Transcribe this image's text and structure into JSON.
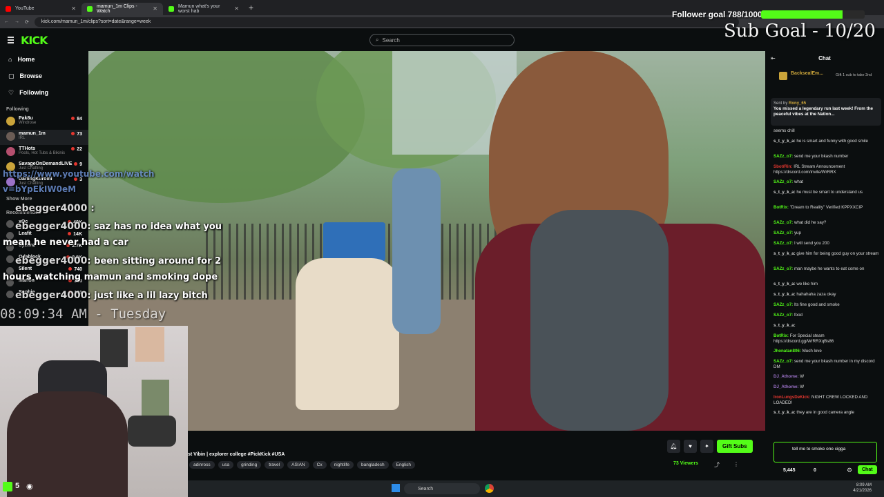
{
  "browser": {
    "tabs": [
      {
        "label": "YouTube",
        "color": "#ff0000"
      },
      {
        "label": "mamun_1m Clips - Watch",
        "color": "#53fc18"
      },
      {
        "label": "Mamun what's your worst hab",
        "color": "#53fc18"
      }
    ],
    "url": "kick.com/mamun_1m/clips?sort=date&range=week"
  },
  "kick": {
    "logo": "KICK",
    "search_placeholder": "Search",
    "nav": {
      "home": "Home",
      "browse": "Browse",
      "following": "Following"
    },
    "following_heading": "Following",
    "channels": [
      {
        "name": "Pak8u",
        "sub": "Windrose",
        "count": "84",
        "color": "#caa43a"
      },
      {
        "name": "mamun_1m",
        "sub": "IRL",
        "count": "73",
        "color": "#6b5c55"
      },
      {
        "name": "TTHots",
        "sub": "Pools, Hot Tubs & Bikinis",
        "count": "22",
        "color": "#b54f6e"
      },
      {
        "name": "SavageOnDemandLIVE",
        "sub": "Just Chatting",
        "count": "9",
        "color": "#caa43a"
      },
      {
        "name": "DarlingKuromi",
        "sub": "Just Chatting",
        "count": "3",
        "color": "#9b72c8"
      }
    ],
    "show_more": "Show More",
    "recommended_heading": "Recommended",
    "recommended": [
      {
        "name": "xQc",
        "sub": "Just Chatting",
        "count": "40K"
      },
      {
        "name": "Leafit",
        "sub": "Just Chatting",
        "count": "14K"
      },
      {
        "name": "Syztmz",
        "sub": "Just Chatting",
        "count": "2.7K"
      },
      {
        "name": "Odablock",
        "sub": "Old School",
        "count": "8.8K"
      },
      {
        "name": "Silent",
        "sub": "VALORANT",
        "count": "740"
      },
      {
        "name": "Marlon",
        "sub": "Grand Theft Auto V (G...",
        "count": "330"
      },
      {
        "name": "Sophie",
        "sub": "Fortnite",
        "count": "101"
      }
    ]
  },
  "overlay": {
    "yt_link_1": "https://www.youtube.com/watch",
    "yt_link_2": "v=bYpEkIW0eM",
    "chat_lines": [
      {
        "user": "ebegger4000 :",
        "text": ""
      },
      {
        "user": "ebegger4000",
        "text": ": saz has no idea what you"
      },
      {
        "user": "",
        "text": "mean he never had a car"
      },
      {
        "user": "ebegger4000",
        "text": ": been sitting around for 2"
      },
      {
        "user": "",
        "text": "hours watching mamun and smoking dope"
      },
      {
        "user": "ebegger4000",
        "text": ": just like a lil lazy bitch"
      }
    ],
    "clock": "08:09:34 AM - Tuesday",
    "follower_goal": "Follower goal 788/1000",
    "follower_progress": 0.788,
    "sub_goal": "Sub Goal - 10/20"
  },
  "stream": {
    "title": "st Vibin | explorer college #PickKick #USA",
    "tags": [
      "adinross",
      "usa",
      "grinding",
      "travel",
      "ASIAN",
      "Cx",
      "nightlife",
      "bangladesh",
      "English"
    ],
    "viewers": "73 Viewers",
    "gift_subs": "Gift Subs"
  },
  "chat": {
    "title": "Chat",
    "top_user": "BacksealEm...",
    "gift_note": "Gift 1 sub to take 2nd",
    "pinned_by": "Sent by",
    "pinned_user": "Rony_65",
    "pinned_text": "You missed a legendary run last week! From the peaceful vibes at the Nation...",
    "messages": [
      {
        "u": "",
        "t": "seems chill",
        "c": "#ddd"
      },
      {
        "u": "s_t_y_k_a:",
        "t": "he is smart and funny with good smile",
        "c": "#ddd"
      },
      {
        "u": "SAZz_o7:",
        "t": "send me your bkash number",
        "c": "#53fc18"
      },
      {
        "u": "Sbot/Rin:",
        "t": "IRL Stream Announcement https://discord.com/invite/WrRRX",
        "c": "#e5372f"
      },
      {
        "u": "SAZz_o7:",
        "t": "what",
        "c": "#53fc18"
      },
      {
        "u": "s_t_y_k_a:",
        "t": "he must be smart to understand us",
        "c": "#ddd"
      },
      {
        "u": "BotRix:",
        "t": "\"Dream to Reality\" Verified KPPXXCIP",
        "c": "#53fc18"
      },
      {
        "u": "SAZz_o7:",
        "t": "what did he say?",
        "c": "#53fc18"
      },
      {
        "u": "SAZz_o7:",
        "t": "yup",
        "c": "#53fc18"
      },
      {
        "u": "SAZz_o7:",
        "t": "I will send you 200",
        "c": "#53fc18"
      },
      {
        "u": "s_t_y_k_a:",
        "t": "give him for being good guy on your stream",
        "c": "#ddd"
      },
      {
        "u": "SAZz_o7:",
        "t": "man maybe he wants to eat come on",
        "c": "#53fc18"
      },
      {
        "u": "s_t_y_k_a:",
        "t": "we like him",
        "c": "#ddd"
      },
      {
        "u": "s_t_y_k_a:",
        "t": "hahahaha zaza okay",
        "c": "#ddd"
      },
      {
        "u": "SAZz_o7:",
        "t": "Its fine good and smoke",
        "c": "#53fc18"
      },
      {
        "u": "SAZz_o7:",
        "t": "food",
        "c": "#53fc18"
      },
      {
        "u": "s_t_y_k_a:",
        "t": "",
        "c": "#ddd"
      },
      {
        "u": "BotRix:",
        "t": "For Special steam https://discord.gg/WrRRXqBs86",
        "c": "#53fc18"
      },
      {
        "u": "Jhonatan806:",
        "t": "Much love",
        "c": "#53fc18"
      },
      {
        "u": "SAZz_o7:",
        "t": "send me your bkash number in my discord DM",
        "c": "#53fc18"
      },
      {
        "u": "DJ_Athome:",
        "t": "W",
        "c": "#9b72c8"
      },
      {
        "u": "DJ_Athome:",
        "t": "W",
        "c": "#9b72c8"
      },
      {
        "u": "IronLungsDeKick:",
        "t": "NIGHT CREW LOCKED AND LOADED!",
        "c": "#e5372f"
      },
      {
        "u": "s_t_y_k_a:",
        "t": "they are in good camera angle",
        "c": "#ddd"
      }
    ],
    "input_text": "tell me to smoke one cigga",
    "points": "5,445",
    "zero": "0",
    "send": "Chat"
  },
  "taskbar": {
    "search": "Search",
    "time": "8:09 AM",
    "date": "4/21/2026"
  },
  "bottom_left_count": "5"
}
